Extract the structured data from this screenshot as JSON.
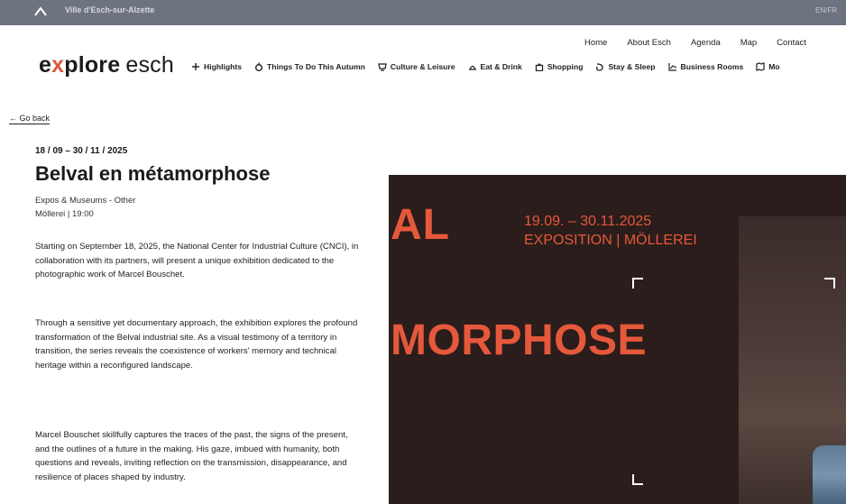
{
  "topbar": {
    "city_label": "Ville d'Esch-sur-Alzette",
    "lang_label": "EN/FR"
  },
  "brand": {
    "part1_pre": "e",
    "part1_x": "x",
    "part1_post": "plore",
    "part2": "esch"
  },
  "utility_nav": [
    "Home",
    "About Esch",
    "Agenda",
    "Map",
    "Contact"
  ],
  "main_nav": [
    {
      "label": "Highlights",
      "icon": "sparkle-icon"
    },
    {
      "label": "Things To Do This Autumn",
      "icon": "leaf-icon"
    },
    {
      "label": "Culture & Leisure",
      "icon": "theatre-icon"
    },
    {
      "label": "Eat & Drink",
      "icon": "cloche-icon"
    },
    {
      "label": "Shopping",
      "icon": "bag-icon"
    },
    {
      "label": "Stay & Sleep",
      "icon": "bed-icon"
    },
    {
      "label": "Business Rooms",
      "icon": "chart-icon"
    },
    {
      "label": "Mo",
      "icon": "map-icon"
    }
  ],
  "goback_label": "← Go back",
  "event": {
    "dates": "18 / 09 – 30 / 11 / 2025",
    "title": "Belval en métamorphose",
    "category": "Expos & Museums - Other",
    "location_time": "Möllerei | 19:00",
    "paragraphs": [
      "Starting on September 18, 2025, the National Center for Industrial Culture (CNCI), in collaboration with its partners, will present a unique exhibition dedicated to the photographic work of Marcel Bouschet.",
      "Through a sensitive yet documentary approach, the exhibition explores the profound transformation of the Belval industrial site. As a visual testimony of a territory in transition, the series reveals the coexistence of workers' memory and technical heritage within a reconfigured landscape.",
      "Marcel Bouschet skillfully captures the traces of the past, the signs of the present, and the outlines of a future in the making. His gaze, imbued with humanity, both questions and reveals, inviting reflection on the transmission, disappearance, and resilience of places shaped by industry."
    ]
  },
  "poster": {
    "big_top": "AL",
    "big_bottom": "MORPHOSE",
    "date_line": "19.09. – 30.11.2025",
    "exhibit_line": "EXPOSITION | MÖLLEREI"
  },
  "colors": {
    "accent": "#e5583b",
    "poster_bg": "#2b1d1b",
    "topbar": "#6e7380"
  }
}
